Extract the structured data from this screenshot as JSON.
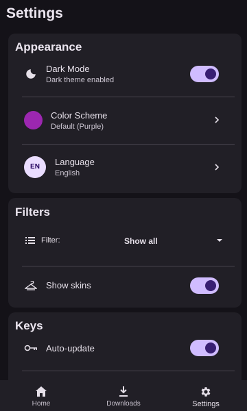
{
  "page": {
    "title": "Settings"
  },
  "appearance": {
    "title": "Appearance",
    "dark_mode": {
      "label": "Dark Mode",
      "subtitle": "Dark theme enabled",
      "enabled": true,
      "icon": "moon-icon"
    },
    "color_scheme": {
      "label": "Color Scheme",
      "subtitle": "Default (Purple)",
      "swatch_color": "#9c27b0"
    },
    "language": {
      "label": "Language",
      "subtitle": "English",
      "badge": "EN"
    }
  },
  "filters": {
    "title": "Filters",
    "filter": {
      "label": "Filter:",
      "value": "Show all",
      "icon": "list-icon"
    },
    "show_skins": {
      "label": "Show skins",
      "enabled": true,
      "icon": "hanger-icon"
    }
  },
  "keys": {
    "title": "Keys",
    "auto_update": {
      "label": "Auto-update",
      "enabled": true,
      "icon": "key-icon"
    }
  },
  "bottom_nav": {
    "items": [
      {
        "label": "Home",
        "icon": "home-icon",
        "active": false
      },
      {
        "label": "Downloads",
        "icon": "download-icon",
        "active": false
      },
      {
        "label": "Settings",
        "icon": "gear-icon",
        "active": true
      }
    ]
  },
  "colors": {
    "background": "#141218",
    "card": "#211f26",
    "accent": "#d0bcff",
    "accent_dark": "#381e72"
  }
}
